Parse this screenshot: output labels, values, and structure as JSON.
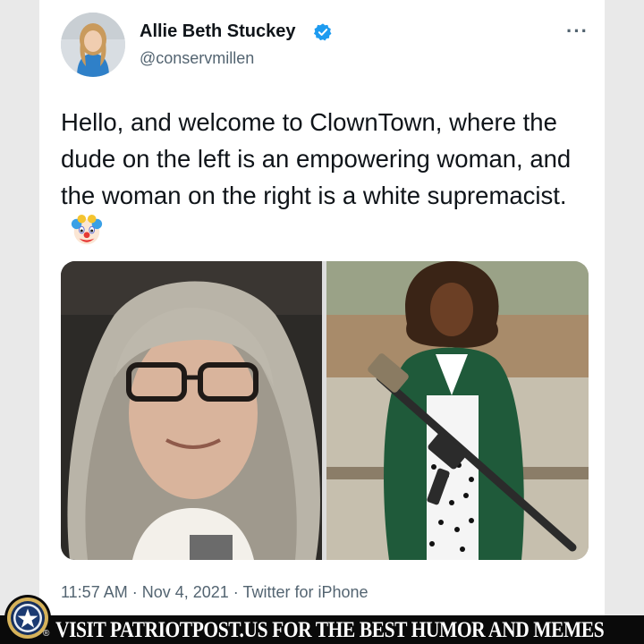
{
  "tweet": {
    "author_name": "Allie Beth Stuckey",
    "author_handle": "@conservmillen",
    "text": "Hello, and welcome to ClownTown, where the dude on the left is an empowering woman, and the woman on the right is a white supremacist.",
    "emoji": "🤡",
    "timestamp": "11:57 AM · Nov 4, 2021 · Twitter for iPhone",
    "more_label": "···"
  },
  "icons": {
    "verified": "verified-badge-icon",
    "more": "more-options-icon",
    "emoji": "clown-face-icon"
  },
  "banner": {
    "text": "VISIT PATRIOTPOST.US FOR THE BEST HUMOR AND MEMES",
    "registered": "®"
  },
  "colors": {
    "verified_blue": "#1d9bf0",
    "text_primary": "#0f1419",
    "text_secondary": "#536471",
    "banner_bg": "#0a0a0a"
  }
}
